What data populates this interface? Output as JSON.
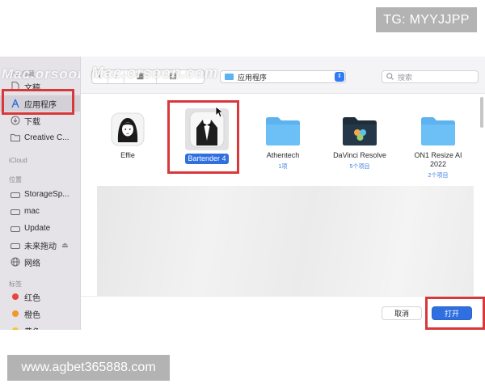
{
  "badge": {
    "text": "TG: MYYJJPP"
  },
  "footer": {
    "url": "www.agbet365888.com"
  },
  "watermark": {
    "text": "Mac.orsoon.com"
  },
  "sidebar": {
    "favorites_header": "个人收藏",
    "items": [
      {
        "label": "文稿",
        "icon": "document-icon"
      },
      {
        "label": "应用程序",
        "icon": "applications-icon",
        "active": true
      },
      {
        "label": "下载",
        "icon": "download-icon"
      },
      {
        "label": "Creative C...",
        "icon": "folder-icon"
      }
    ],
    "icloud_header": "iCloud",
    "locations_header": "位置",
    "locations": [
      {
        "label": "StorageSp...",
        "icon": "drive-icon"
      },
      {
        "label": "mac",
        "icon": "drive-icon"
      },
      {
        "label": "Update",
        "icon": "drive-icon"
      },
      {
        "label": "未来拖动",
        "icon": "drive-icon",
        "eject": "⏏"
      },
      {
        "label": "网络",
        "icon": "network-icon"
      }
    ],
    "tags_header": "标签",
    "tags": [
      {
        "label": "红色",
        "color": "#e8453c"
      },
      {
        "label": "橙色",
        "color": "#f2962e"
      },
      {
        "label": "黄色",
        "color": "#f5c430"
      }
    ]
  },
  "toolbar": {
    "back": "‹",
    "forward": "›",
    "view_grid": "▦",
    "view_list": "▤",
    "location": "应用程序",
    "search_placeholder": "搜索"
  },
  "files": [
    {
      "name": "Effie",
      "meta": "",
      "icon": "effie-app-icon"
    },
    {
      "name": "Bartender 4",
      "meta": "",
      "icon": "bartender-app-icon",
      "selected": true
    },
    {
      "name": "Athentech",
      "meta": "1项",
      "icon": "folder-icon"
    },
    {
      "name": "DaVinci Resolve",
      "meta": "5个项目",
      "icon": "davinci-folder-icon"
    },
    {
      "name": "ON1 Resize AI 2022",
      "meta": "2个项目",
      "icon": "folder-icon"
    }
  ],
  "buttons": {
    "cancel": "取消",
    "open": "打开"
  },
  "colors": {
    "accent": "#2f6fe0",
    "highlight": "#d9383b",
    "folder": "#5eb2f0"
  }
}
